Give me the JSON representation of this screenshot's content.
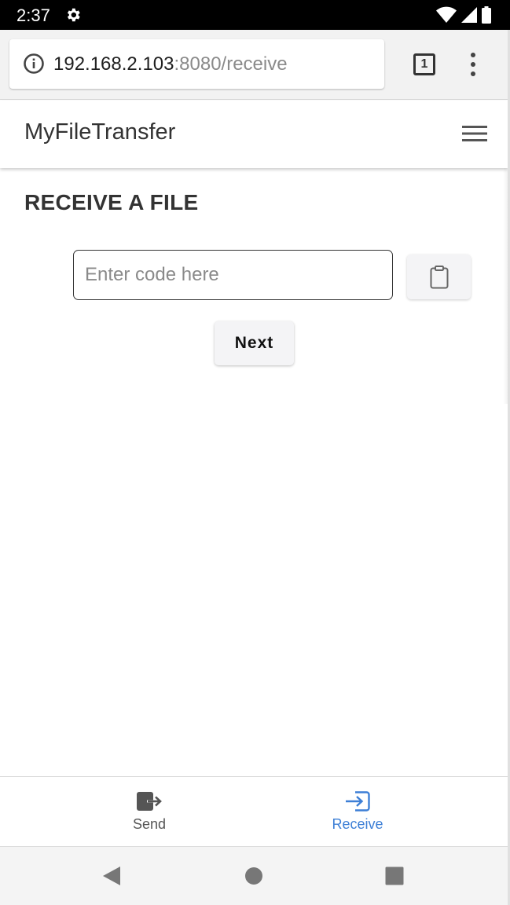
{
  "status_bar": {
    "time": "2:37"
  },
  "browser": {
    "url_host": "192.168.2.103",
    "url_path": ":8080/receive",
    "tab_count": "1"
  },
  "app": {
    "brand": "MyFileTransfer"
  },
  "page": {
    "title": "RECEIVE A FILE",
    "code_input": {
      "placeholder": "Enter code here",
      "value": ""
    },
    "next_label": "Next"
  },
  "bottom_tabs": [
    {
      "label": "Send",
      "icon": "send-icon",
      "active": false
    },
    {
      "label": "Receive",
      "icon": "receive-icon",
      "active": true
    }
  ],
  "colors": {
    "accent": "#3d7fd6",
    "text": "#333333"
  }
}
